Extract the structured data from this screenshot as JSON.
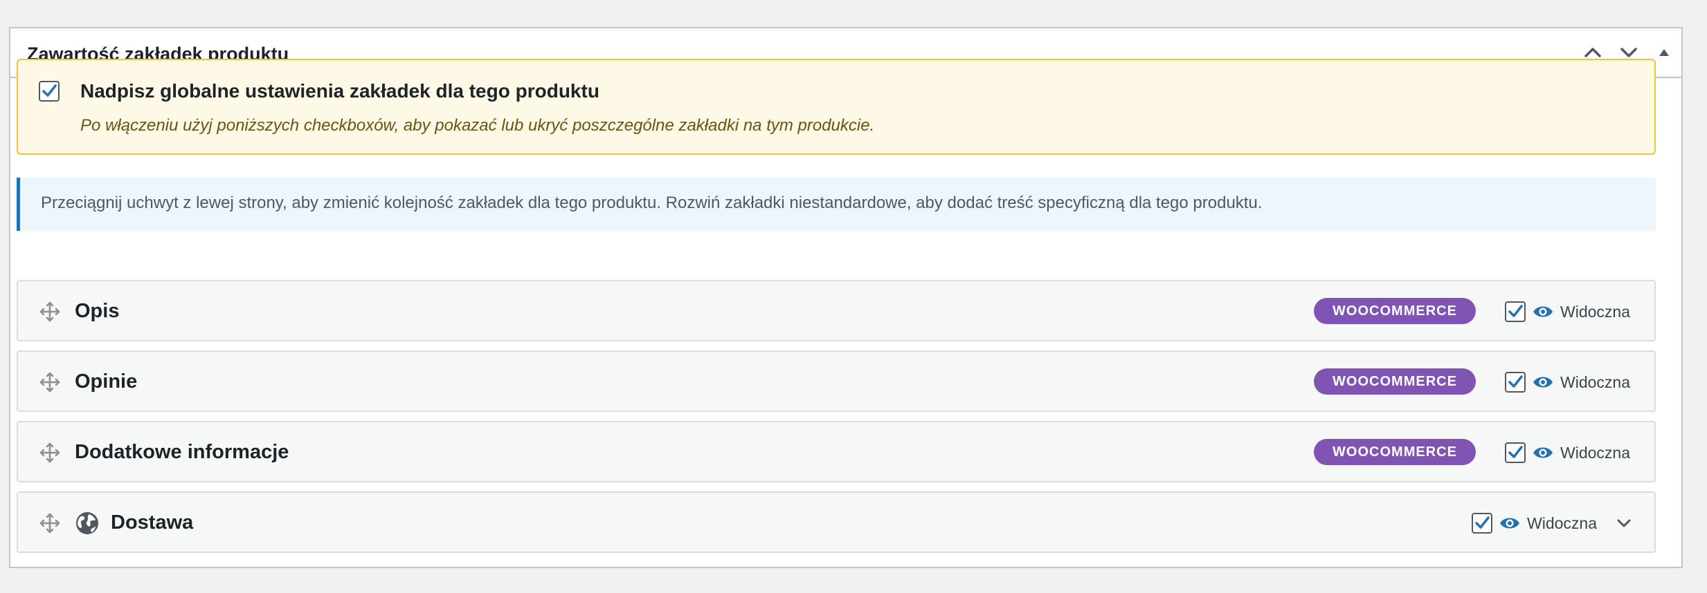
{
  "metabox": {
    "title": "Zawartość zakładek produktu",
    "controls": [
      {
        "name": "move-up",
        "icon": "chevron-up-icon"
      },
      {
        "name": "move-down",
        "icon": "chevron-down-icon"
      },
      {
        "name": "toggle-panel",
        "icon": "triangle-up-icon"
      }
    ]
  },
  "override": {
    "checked": true,
    "title": "Nadpisz globalne ustawienia zakładek dla tego produktu",
    "description": "Po włączeniu użyj poniższych checkboxów, aby pokazać lub ukryć poszczególne zakładki na tym produkcie."
  },
  "info": {
    "text": "Przeciągnij uchwyt z lewej strony, aby zmienić kolejność zakładek dla tego produktu. Rozwiń zakładki niestandardowe, aby dodać treść specyficzną dla tego produktu."
  },
  "tabs": [
    {
      "title": "Opis",
      "badge": "WOOCOMMERCE",
      "visible": true,
      "visibility_label": "Widoczna",
      "icon": null,
      "expandable": false
    },
    {
      "title": "Opinie",
      "badge": "WOOCOMMERCE",
      "visible": true,
      "visibility_label": "Widoczna",
      "icon": null,
      "expandable": false
    },
    {
      "title": "Dodatkowe informacje",
      "badge": "WOOCOMMERCE",
      "visible": true,
      "visibility_label": "Widoczna",
      "icon": null,
      "expandable": false
    },
    {
      "title": "Dostawa",
      "badge": null,
      "visible": true,
      "visibility_label": "Widoczna",
      "icon": "globe-icon",
      "expandable": true
    }
  ],
  "colors": {
    "accent": "#2271b1",
    "badge": "#7f54b3",
    "notice_bg": "#fef8e6",
    "notice_border": "#f0c33c",
    "info_bg": "#eef5fd"
  }
}
